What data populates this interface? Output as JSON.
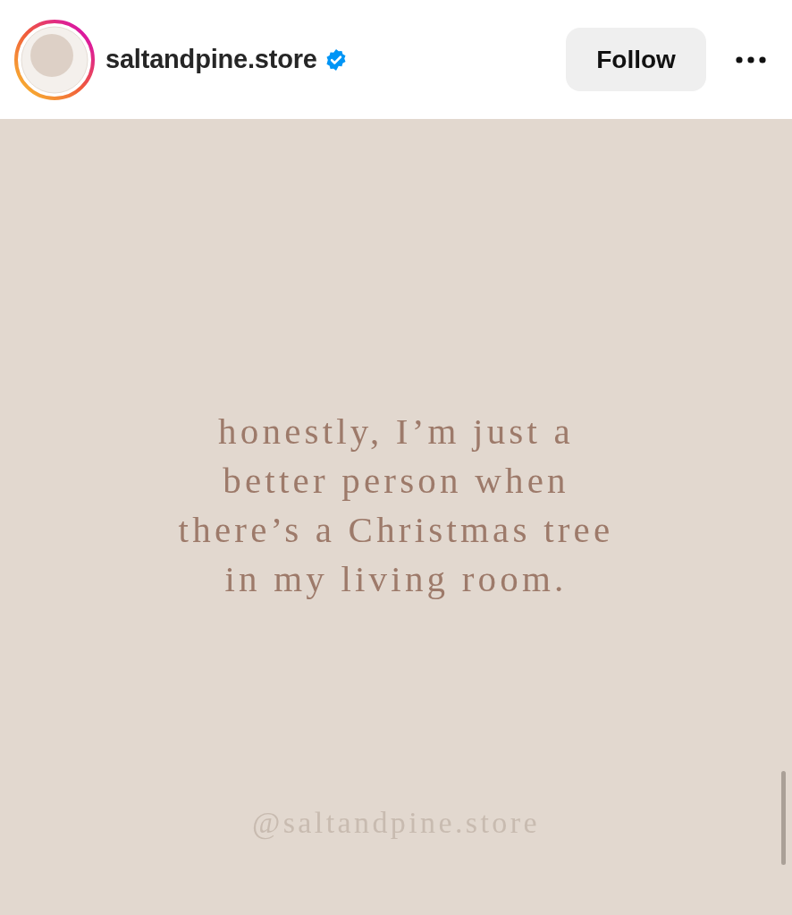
{
  "header": {
    "username": "saltandpine.store",
    "verified": true,
    "follow_button": "Follow"
  },
  "post": {
    "quote": "honestly, I’m just a\nbetter person when\nthere’s a Christmas tree\nin my living room.",
    "handle": "@saltandpine.store"
  }
}
